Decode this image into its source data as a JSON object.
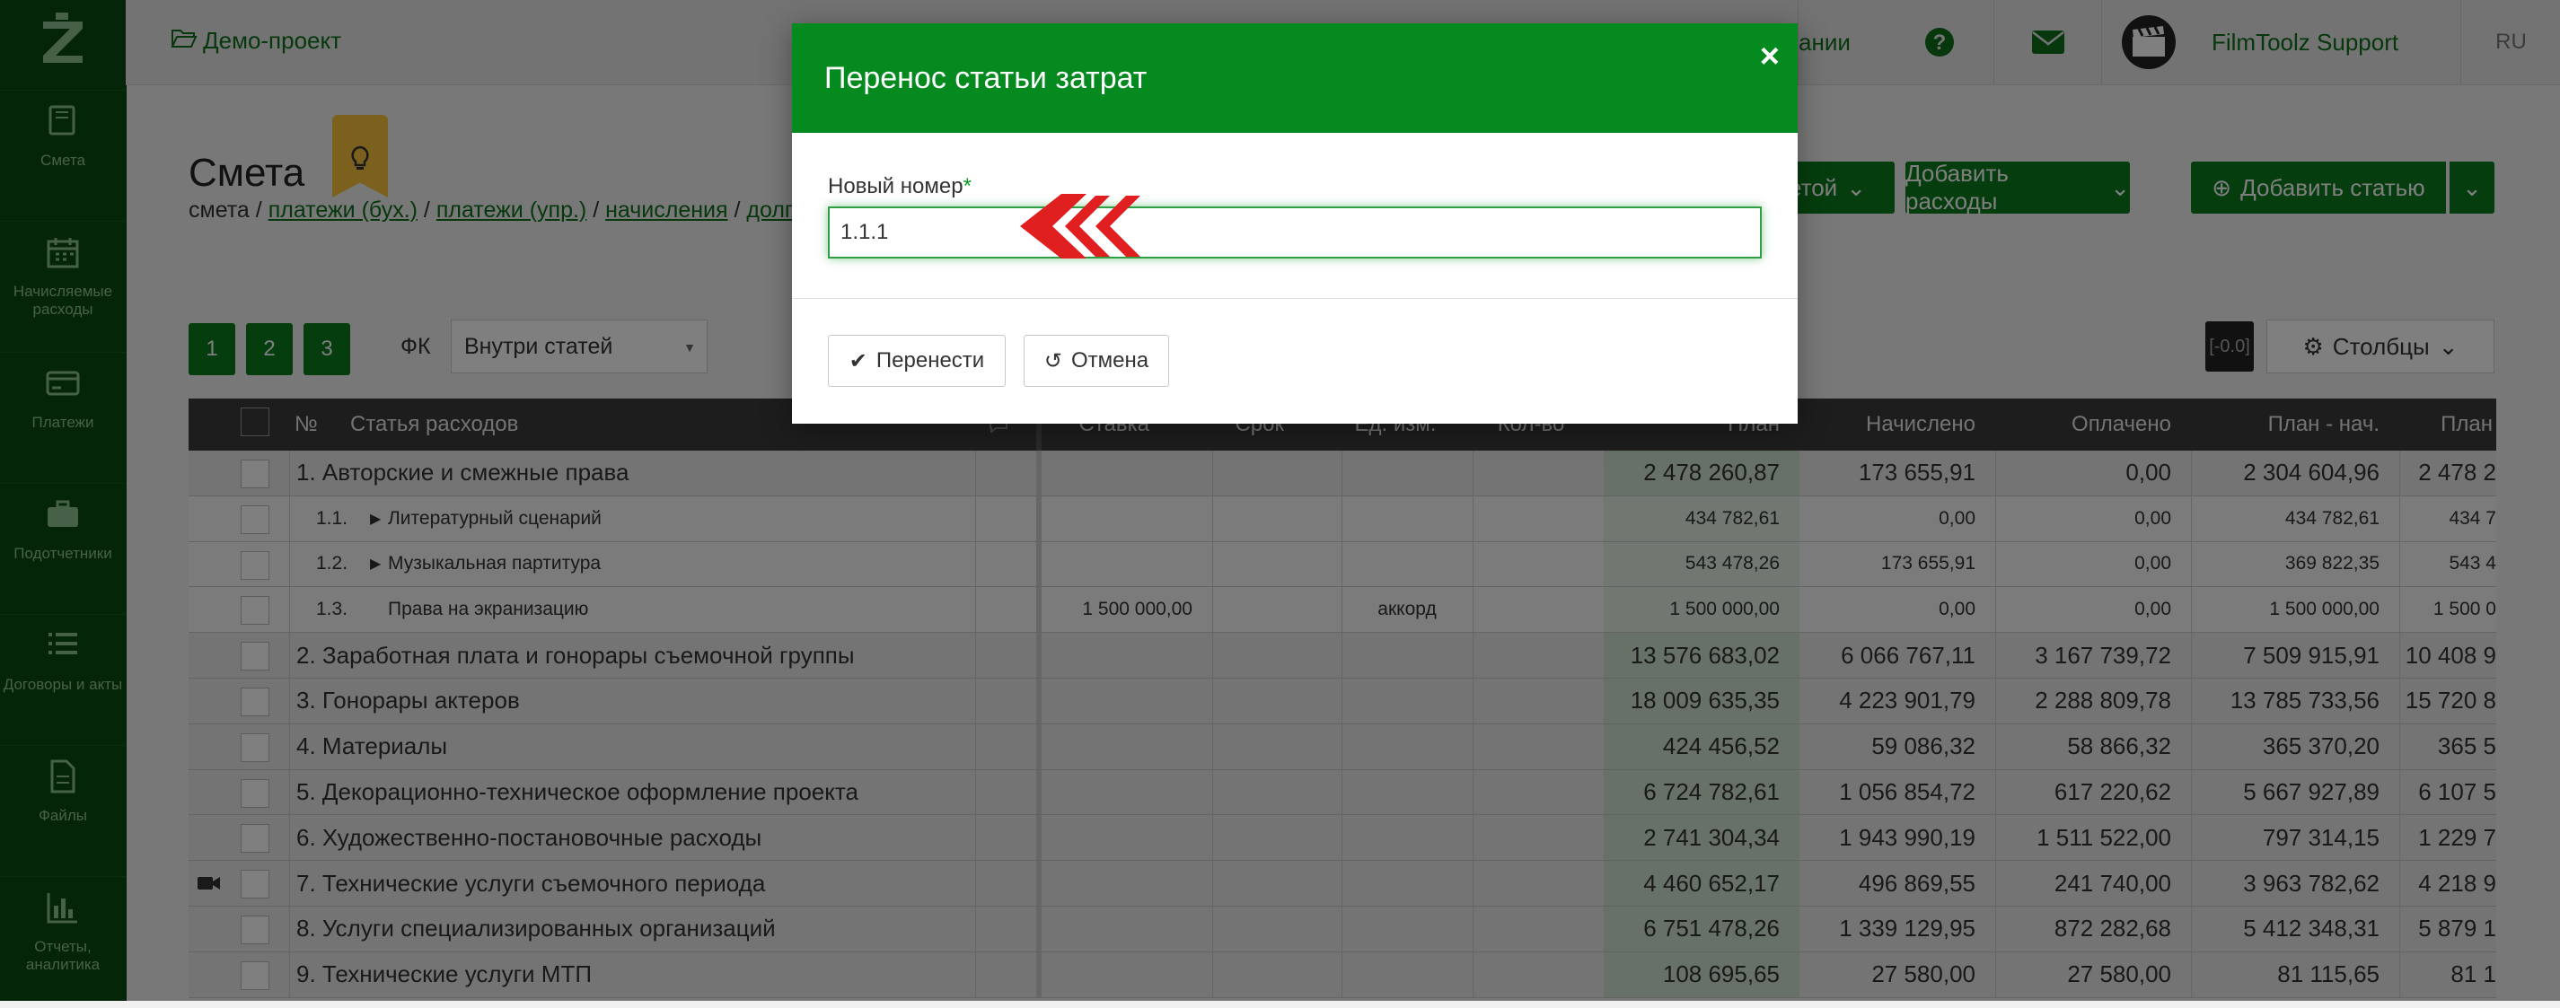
{
  "sidebar": {
    "items": [
      {
        "label": "Смета",
        "icon": "book-icon"
      },
      {
        "label": "Начисляемые расходы",
        "icon": "calendar-icon"
      },
      {
        "label": "Платежи",
        "icon": "credit-card-icon"
      },
      {
        "label": "Подотчетники",
        "icon": "briefcase-icon"
      },
      {
        "label": "Договоры и акты",
        "icon": "list-icon"
      },
      {
        "label": "Файлы",
        "icon": "file-icon"
      },
      {
        "label": "Отчеты, аналитика",
        "icon": "bar-chart-icon"
      }
    ]
  },
  "header": {
    "project": "Демо-проект",
    "partial_link": "ании",
    "user": "FilmToolz Support",
    "lang": "RU"
  },
  "page": {
    "title": "Смета",
    "tabs": {
      "current": "смета",
      "links": [
        "платежи (бух.)",
        "платежи (упр.)",
        "начисления",
        "долг"
      ],
      "sep": " / "
    },
    "buttons": {
      "partial_budget": "етой",
      "add_expenses": "Добавить расходы",
      "add_item": "Добавить статью"
    },
    "pages": [
      "1",
      "2",
      "3"
    ],
    "fk_label": "ФК",
    "fk_value": "Внутри статей",
    "counter": "[-0.0]",
    "columns_btn": "Столбцы"
  },
  "table": {
    "headers": {
      "no": "№",
      "item": "Статья расходов",
      "rate": "Ставка",
      "term": "Срок",
      "unit": "Ед. изм.",
      "qty": "Кол-во",
      "plan": "План",
      "accrued": "Начислено",
      "paid": "Оплачено",
      "plan_acc": "План - нач.",
      "plan_paid": "План"
    },
    "rows": [
      {
        "level": "top",
        "no": "",
        "item": "1. Авторские и смежные права",
        "rate": "",
        "unit": "",
        "plan": "2 478 260,87",
        "accrued": "173 655,91",
        "paid": "0,00",
        "plan_acc": "2 304 604,96",
        "plan_paid": "2 478 2"
      },
      {
        "level": "sub",
        "no": "1.1.",
        "item": "Литературный сценарий",
        "caret": true,
        "rate": "",
        "unit": "",
        "plan": "434 782,61",
        "accrued": "0,00",
        "paid": "0,00",
        "plan_acc": "434 782,61",
        "plan_paid": "434 7"
      },
      {
        "level": "sub",
        "no": "1.2.",
        "item": "Музыкальная партитура",
        "caret": true,
        "rate": "",
        "unit": "",
        "plan": "543 478,26",
        "accrued": "173 655,91",
        "paid": "0,00",
        "plan_acc": "369 822,35",
        "plan_paid": "543 4"
      },
      {
        "level": "sub",
        "no": "1.3.",
        "item": "Права на экранизацию",
        "caret": false,
        "rate": "1 500 000,00",
        "unit": "аккорд",
        "plan": "1 500 000,00",
        "accrued": "0,00",
        "paid": "0,00",
        "plan_acc": "1 500 000,00",
        "plan_paid": "1 500 0"
      },
      {
        "level": "top",
        "no": "",
        "item": "2. Заработная плата и гонорары съемочной группы",
        "rate": "",
        "unit": "",
        "plan": "13 576 683,02",
        "accrued": "6 066 767,11",
        "paid": "3 167 739,72",
        "plan_acc": "7 509 915,91",
        "plan_paid": "10 408 9"
      },
      {
        "level": "top",
        "no": "",
        "item": "3. Гонорары актеров",
        "rate": "",
        "unit": "",
        "plan": "18 009 635,35",
        "accrued": "4 223 901,79",
        "paid": "2 288 809,78",
        "plan_acc": "13 785 733,56",
        "plan_paid": "15 720 8"
      },
      {
        "level": "top",
        "no": "",
        "item": "4. Материалы",
        "rate": "",
        "unit": "",
        "plan": "424 456,52",
        "accrued": "59 086,32",
        "paid": "58 866,32",
        "plan_acc": "365 370,20",
        "plan_paid": "365 5"
      },
      {
        "level": "top",
        "no": "",
        "item": "5. Декорационно-техническое оформление проекта",
        "rate": "",
        "unit": "",
        "plan": "6 724 782,61",
        "accrued": "1 056 854,72",
        "paid": "617 220,62",
        "plan_acc": "5 667 927,89",
        "plan_paid": "6 107 5"
      },
      {
        "level": "top",
        "no": "",
        "item": "6. Художественно-постановочные расходы",
        "rate": "",
        "unit": "",
        "plan": "2 741 304,34",
        "accrued": "1 943 990,19",
        "paid": "1 511 522,00",
        "plan_acc": "797 314,15",
        "plan_paid": "1 229 7"
      },
      {
        "level": "top",
        "no": "",
        "item": "7. Технические услуги съемочного периода",
        "video": true,
        "rate": "",
        "unit": "",
        "plan": "4 460 652,17",
        "accrued": "496 869,55",
        "paid": "241 740,00",
        "plan_acc": "3 963 782,62",
        "plan_paid": "4 218 9"
      },
      {
        "level": "top",
        "no": "",
        "item": "8. Услуги специализированных организаций",
        "rate": "",
        "unit": "",
        "plan": "6 751 478,26",
        "accrued": "1 339 129,95",
        "paid": "872 282,68",
        "plan_acc": "5 412 348,31",
        "plan_paid": "5 879 1"
      },
      {
        "level": "top",
        "no": "",
        "item": "9. Технические услуги МТП",
        "rate": "",
        "unit": "",
        "plan": "108 695,65",
        "accrued": "27 580,00",
        "paid": "27 580,00",
        "plan_acc": "81 115,65",
        "plan_paid": "81 1"
      }
    ]
  },
  "modal": {
    "title": "Перенос статьи затрат",
    "field_label": "Новый номер",
    "required_mark": "*",
    "field_value": "1.1.1",
    "submit": "Перенести",
    "cancel": "Отмена"
  }
}
